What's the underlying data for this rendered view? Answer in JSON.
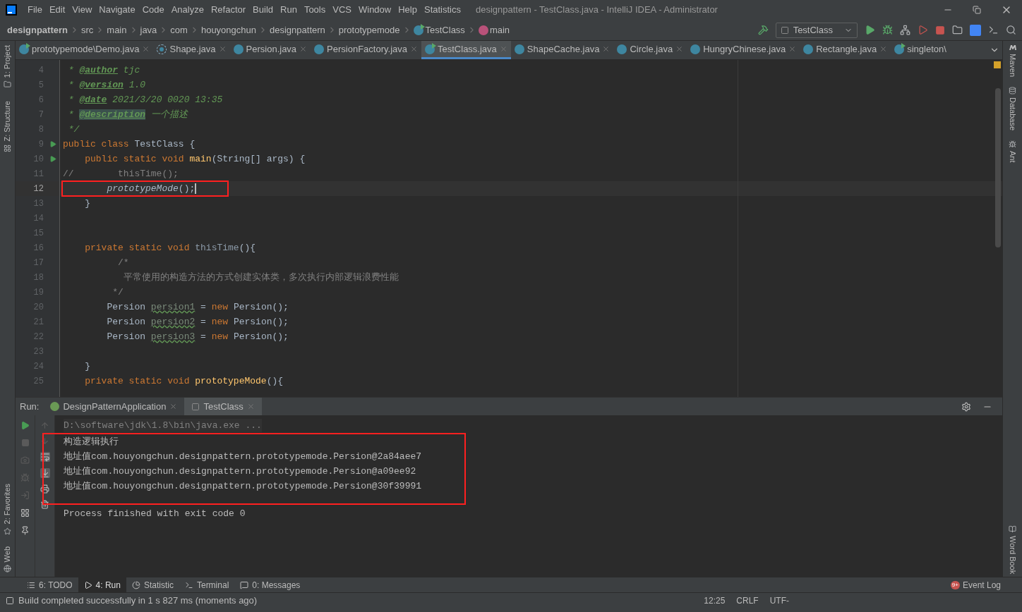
{
  "window": {
    "title": "designpattern - TestClass.java - IntelliJ IDEA - Administrator"
  },
  "menu": [
    "File",
    "Edit",
    "View",
    "Navigate",
    "Code",
    "Analyze",
    "Refactor",
    "Build",
    "Run",
    "Tools",
    "VCS",
    "Window",
    "Help",
    "Statistics"
  ],
  "breadcrumbs": [
    {
      "label": "designpattern",
      "kind": "project"
    },
    {
      "label": "src",
      "kind": "folder"
    },
    {
      "label": "main",
      "kind": "folder"
    },
    {
      "label": "java",
      "kind": "folder"
    },
    {
      "label": "com",
      "kind": "folder"
    },
    {
      "label": "houyongchun",
      "kind": "folder"
    },
    {
      "label": "designpattern",
      "kind": "folder"
    },
    {
      "label": "prototypemode",
      "kind": "folder"
    },
    {
      "label": "TestClass",
      "kind": "class"
    },
    {
      "label": "main",
      "kind": "method"
    }
  ],
  "run_config": "TestClass",
  "editor_tabs": [
    {
      "label": "prototypemode\\Demo.java",
      "kind": "runnable",
      "selected": false,
      "closable": true
    },
    {
      "label": "Shape.java",
      "kind": "abstract",
      "selected": false,
      "closable": true
    },
    {
      "label": "Persion.java",
      "kind": "class",
      "selected": false,
      "closable": true
    },
    {
      "label": "PersionFactory.java",
      "kind": "class",
      "selected": false,
      "closable": true
    },
    {
      "label": "TestClass.java",
      "kind": "runnable",
      "selected": true,
      "closable": true
    },
    {
      "label": "ShapeCache.java",
      "kind": "class",
      "selected": false,
      "closable": true
    },
    {
      "label": "Circle.java",
      "kind": "class",
      "selected": false,
      "closable": true
    },
    {
      "label": "HungryChinese.java",
      "kind": "class",
      "selected": false,
      "closable": true
    },
    {
      "label": "Rectangle.java",
      "kind": "class",
      "selected": false,
      "closable": true
    },
    {
      "label": "singleton\\",
      "kind": "runnable",
      "selected": false,
      "closable": false
    }
  ],
  "left_tool_windows": [
    {
      "label": "1: Project",
      "kind": "folder"
    },
    {
      "label": "Z: Structure",
      "kind": "structure"
    }
  ],
  "left_tool_windows_bottom": [
    {
      "label": "2: Favorites",
      "kind": "star"
    },
    {
      "label": "Web",
      "kind": "globe"
    }
  ],
  "right_tool_windows": [
    {
      "label": "Maven",
      "kind": "maven"
    },
    {
      "label": "Database",
      "kind": "database"
    },
    {
      "label": "Ant",
      "kind": "ant"
    }
  ],
  "right_tool_windows_bottom": [
    {
      "label": "Word Book",
      "kind": "book"
    }
  ],
  "code_lines": [
    {
      "number": "4",
      "run": false,
      "current": false,
      "tokens": [
        {
          "text": " * ",
          "kind": "doc"
        },
        {
          "text": "@author",
          "kind": "doctag"
        },
        {
          "text": " tjc",
          "kind": "doc"
        }
      ]
    },
    {
      "number": "5",
      "run": false,
      "current": false,
      "tokens": [
        {
          "text": " * ",
          "kind": "doc"
        },
        {
          "text": "@version",
          "kind": "doctag"
        },
        {
          "text": " 1.0",
          "kind": "doc"
        }
      ]
    },
    {
      "number": "6",
      "run": false,
      "current": false,
      "tokens": [
        {
          "text": " * ",
          "kind": "doc"
        },
        {
          "text": "@date",
          "kind": "doctag"
        },
        {
          "text": " 2021/3/20 0020 13:35",
          "kind": "doc"
        }
      ]
    },
    {
      "number": "7",
      "run": false,
      "current": false,
      "tokens": [
        {
          "text": " * ",
          "kind": "doc"
        },
        {
          "text": "@description",
          "kind": "doctagmark"
        },
        {
          "text": " 一个描述",
          "kind": "doc"
        }
      ]
    },
    {
      "number": "8",
      "run": false,
      "current": false,
      "tokens": [
        {
          "text": " */",
          "kind": "doc"
        }
      ]
    },
    {
      "number": "9",
      "run": true,
      "current": false,
      "tokens": [
        {
          "text": "public class ",
          "kind": "keyword"
        },
        {
          "text": "TestClass {",
          "kind": "plain"
        }
      ]
    },
    {
      "number": "10",
      "run": true,
      "current": false,
      "tokens": [
        {
          "text": "    public static void ",
          "kind": "keyword"
        },
        {
          "text": "main",
          "kind": "method"
        },
        {
          "text": "(String[] args) {",
          "kind": "plain"
        }
      ]
    },
    {
      "number": "11",
      "run": false,
      "current": false,
      "tokens": [
        {
          "text": "//        thisTime();",
          "kind": "comment"
        }
      ]
    },
    {
      "number": "12",
      "run": false,
      "current": true,
      "tokens": [
        {
          "text": "        prototypeMode",
          "kind": "call"
        },
        {
          "text": "();",
          "kind": "plain"
        }
      ]
    },
    {
      "number": "13",
      "run": false,
      "current": false,
      "tokens": [
        {
          "text": "    }",
          "kind": "plain"
        }
      ]
    },
    {
      "number": "14",
      "run": false,
      "current": false
    },
    {
      "number": "15",
      "run": false,
      "current": false
    },
    {
      "number": "16",
      "run": false,
      "current": false,
      "tokens": [
        {
          "text": "    private static void ",
          "kind": "keyword"
        },
        {
          "text": "thisTime",
          "kind": "unused"
        },
        {
          "text": "(){",
          "kind": "plain"
        }
      ]
    },
    {
      "number": "17",
      "run": false,
      "current": false,
      "tokens": [
        {
          "text": "          /*",
          "kind": "comment"
        }
      ]
    },
    {
      "number": "18",
      "run": false,
      "current": false,
      "tokens": [
        {
          "text": "           平常使用的构造方法的方式创建实体类，多次执行内部逻辑浪费性能",
          "kind": "comment"
        }
      ]
    },
    {
      "number": "19",
      "run": false,
      "current": false,
      "tokens": [
        {
          "text": "         */",
          "kind": "comment"
        }
      ]
    },
    {
      "number": "20",
      "run": false,
      "current": false,
      "tokens": [
        {
          "text": "        Persion ",
          "kind": "plain"
        },
        {
          "text": "persion1",
          "kind": "unusedvar"
        },
        {
          "text": " = ",
          "kind": "plain"
        },
        {
          "text": "new ",
          "kind": "keyword"
        },
        {
          "text": "Persion();",
          "kind": "plain"
        }
      ]
    },
    {
      "number": "21",
      "run": false,
      "current": false,
      "tokens": [
        {
          "text": "        Persion ",
          "kind": "plain"
        },
        {
          "text": "persion2",
          "kind": "unusedvar"
        },
        {
          "text": " = ",
          "kind": "plain"
        },
        {
          "text": "new ",
          "kind": "keyword"
        },
        {
          "text": "Persion();",
          "kind": "plain"
        }
      ]
    },
    {
      "number": "22",
      "run": false,
      "current": false,
      "tokens": [
        {
          "text": "        Persion ",
          "kind": "plain"
        },
        {
          "text": "persion3",
          "kind": "unusedvar"
        },
        {
          "text": " = ",
          "kind": "plain"
        },
        {
          "text": "new ",
          "kind": "keyword"
        },
        {
          "text": "Persion();",
          "kind": "plain"
        }
      ]
    },
    {
      "number": "23",
      "run": false,
      "current": false
    },
    {
      "number": "24",
      "run": false,
      "current": false,
      "tokens": [
        {
          "text": "    }",
          "kind": "plain"
        }
      ]
    },
    {
      "number": "25",
      "run": false,
      "current": false,
      "tokens": [
        {
          "text": "    private static void ",
          "kind": "keyword"
        },
        {
          "text": "prototypeMode",
          "kind": "method"
        },
        {
          "text": "(){",
          "kind": "plain"
        }
      ]
    }
  ],
  "run_panel": {
    "title": "Run:",
    "tabs": [
      {
        "label": "DesignPatternApplication",
        "selected": false
      },
      {
        "label": "TestClass",
        "selected": true
      }
    ],
    "console": [
      {
        "text": "D:\\software\\jdk\\1.8\\bin\\java.exe ...",
        "kind": "command",
        "marked": false
      },
      {
        "text": "构造逻辑执行",
        "kind": "output",
        "marked": true
      },
      {
        "text": "地址值com.houyongchun.designpattern.prototypemode.Persion@2a84aee7",
        "kind": "output",
        "marked": true
      },
      {
        "text": "地址值com.houyongchun.designpattern.prototypemode.Persion@a09ee92",
        "kind": "output",
        "marked": true
      },
      {
        "text": "地址值com.houyongchun.designpattern.prototypemode.Persion@30f39991",
        "kind": "output",
        "marked": true
      },
      {
        "text": "Process finished with exit code 0",
        "kind": "output",
        "marked": false
      }
    ]
  },
  "bottom_tabs": [
    {
      "label": "6: TODO",
      "kind": "todo",
      "selected": false
    },
    {
      "label": "4: Run",
      "kind": "run",
      "selected": true
    },
    {
      "label": "Statistic",
      "kind": "statistic",
      "selected": false
    },
    {
      "label": "Terminal",
      "kind": "terminal",
      "selected": false
    },
    {
      "label": "0: Messages",
      "kind": "messages",
      "selected": false
    }
  ],
  "event_log": {
    "label": "Event Log",
    "badge": "9+"
  },
  "status_bar": {
    "message": "Build completed successfully in 1 s 827 ms (moments ago)",
    "items": [
      "12:25",
      "CRLF",
      "UTF-"
    ]
  }
}
